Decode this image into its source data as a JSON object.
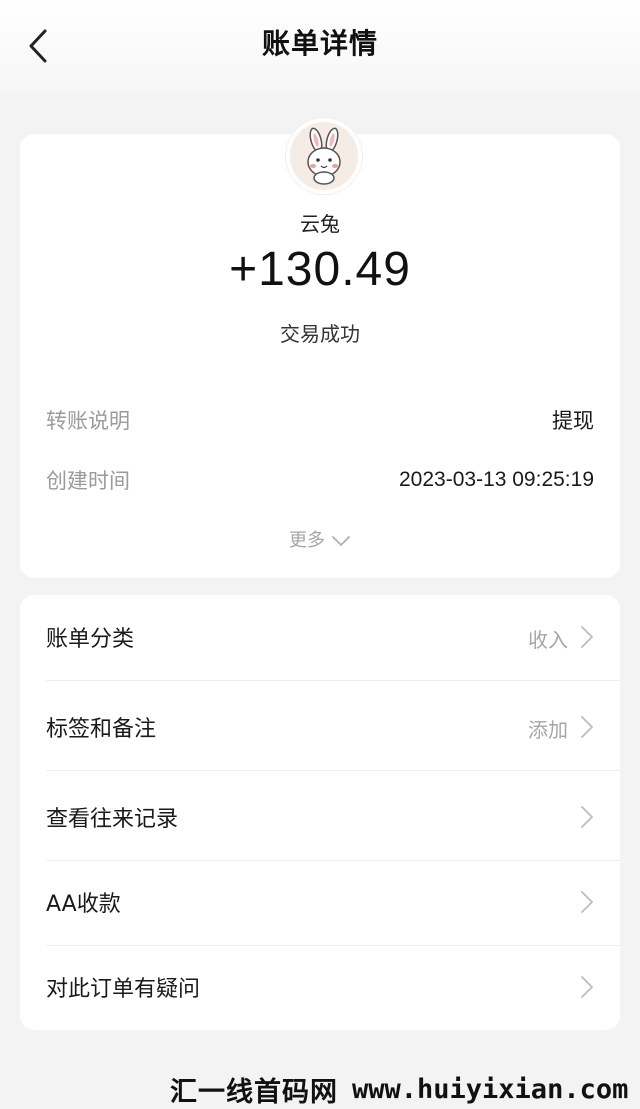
{
  "header": {
    "title": "账单详情",
    "back_icon": "chevron-left-icon"
  },
  "summary": {
    "avatar_icon": "rabbit-avatar-icon",
    "payee": "云兔",
    "amount": "+130.49",
    "status": "交易成功",
    "details": [
      {
        "label": "转账说明",
        "value": "提现"
      },
      {
        "label": "创建时间",
        "value": "2023-03-13 09:25:19"
      }
    ],
    "more_label": "更多"
  },
  "menu": {
    "items": [
      {
        "label": "账单分类",
        "value": "收入"
      },
      {
        "label": "标签和备注",
        "value": "添加"
      },
      {
        "label": "查看往来记录",
        "value": ""
      },
      {
        "label": "AA收款",
        "value": ""
      },
      {
        "label": "对此订单有疑问",
        "value": ""
      }
    ]
  },
  "watermark": {
    "text": "汇一线首码网",
    "url": "www.huiyixian.com"
  },
  "colors": {
    "background": "#f3f3f3",
    "card": "#ffffff",
    "muted_text": "#9b9b9b"
  }
}
